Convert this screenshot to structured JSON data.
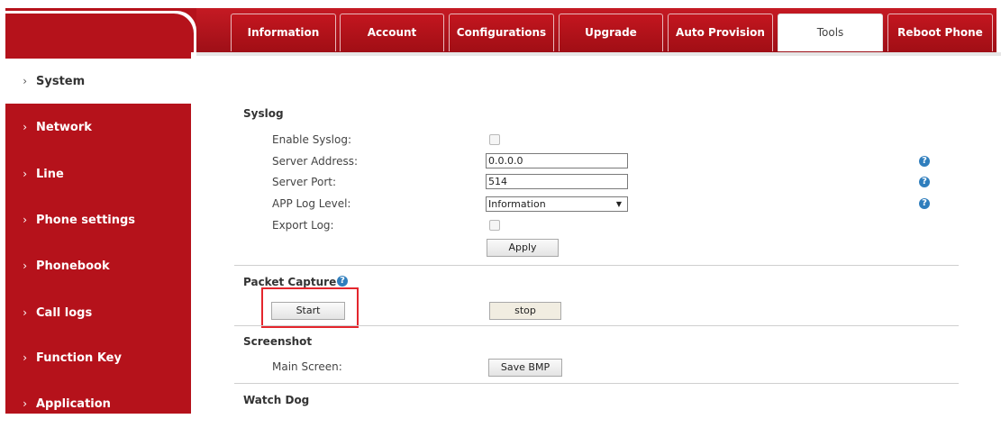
{
  "tabs": [
    {
      "label": "Information",
      "active": false
    },
    {
      "label": "Account",
      "active": false
    },
    {
      "label": "Configurations",
      "active": false
    },
    {
      "label": "Upgrade",
      "active": false
    },
    {
      "label": "Auto Provision",
      "active": false
    },
    {
      "label": "Tools",
      "active": true
    },
    {
      "label": "Reboot Phone",
      "active": false
    }
  ],
  "sidebar": {
    "chevron": "›",
    "items": [
      {
        "label": "System",
        "active": true
      },
      {
        "label": "Network"
      },
      {
        "label": "Line"
      },
      {
        "label": "Phone settings"
      },
      {
        "label": "Phonebook"
      },
      {
        "label": "Call logs"
      },
      {
        "label": "Function Key"
      },
      {
        "label": "Application"
      }
    ]
  },
  "syslog": {
    "title": "Syslog",
    "enable_label": "Enable Syslog:",
    "enable_checked": false,
    "server_address_label": "Server Address:",
    "server_address_value": "0.0.0.0",
    "server_port_label": "Server Port:",
    "server_port_value": "514",
    "log_level_label": "APP Log Level:",
    "log_level_value": "Information",
    "export_label": "Export Log:",
    "export_checked": false,
    "apply_label": "Apply"
  },
  "packet_capture": {
    "title": "Packet Capture",
    "start_label": "Start",
    "stop_label": "stop"
  },
  "screenshot": {
    "title": "Screenshot",
    "main_screen_label": "Main Screen:",
    "save_label": "Save BMP"
  },
  "watchdog": {
    "title": "Watch Dog"
  },
  "icons": {
    "help": "?",
    "dropdown": "▼"
  },
  "colors": {
    "brand_red": "#b5121b",
    "help_blue": "#2f7ebd",
    "highlight": "#e4262d"
  }
}
